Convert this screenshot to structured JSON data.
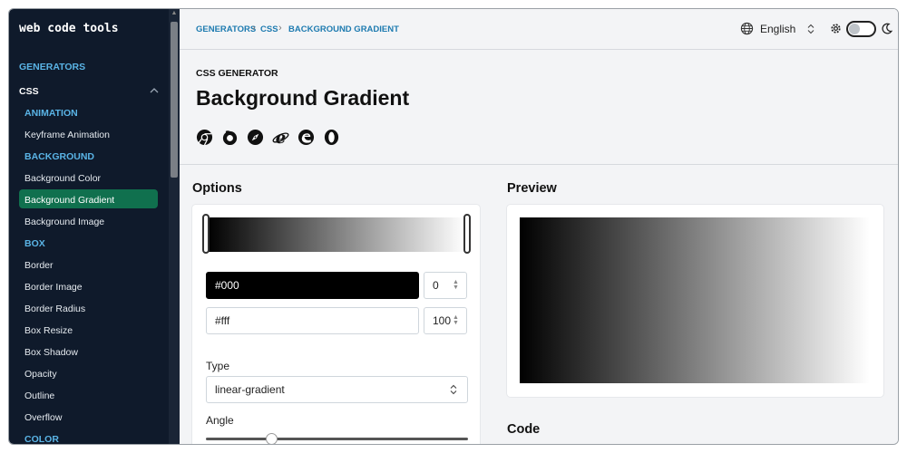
{
  "sidebar": {
    "logo": "web code tools",
    "section_generators": "GENERATORS",
    "section_css": "CSS",
    "categories": [
      "ANIMATION",
      "BACKGROUND",
      "BOX",
      "COLOR"
    ],
    "items": [
      "Keyframe Animation",
      "Background Color",
      "Background Gradient",
      "Background Image",
      "Border",
      "Border Image",
      "Border Radius",
      "Box Resize",
      "Box Shadow",
      "Opacity",
      "Outline",
      "Overflow"
    ],
    "active_item": "Background Gradient"
  },
  "topbar": {
    "breadcrumb": [
      "GENERATORS",
      "CSS",
      "BACKGROUND GRADIENT"
    ],
    "language": "English"
  },
  "header": {
    "eyebrow": "CSS GENERATOR",
    "title": "Background Gradient",
    "browser_icons": [
      "chrome-icon",
      "firefox-icon",
      "safari-icon",
      "ie-icon",
      "edge-icon",
      "opera-icon"
    ]
  },
  "options": {
    "heading": "Options",
    "stop1_color": "#000",
    "stop1_pos": "0",
    "stop2_color": "#fff",
    "stop2_pos": "100",
    "type_label": "Type",
    "type_value": "linear-gradient",
    "angle_label": "Angle",
    "angle_fraction": 0.25
  },
  "preview": {
    "heading": "Preview"
  },
  "code": {
    "heading": "Code"
  },
  "colors": {
    "sidebar_bg": "#0f1a2b",
    "active_bg": "#10704e",
    "category": "#5ab4e6",
    "crumb": "#1e7bb0"
  }
}
